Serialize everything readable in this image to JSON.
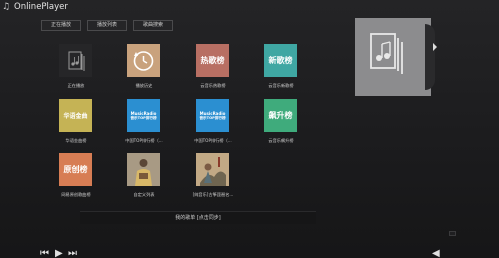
{
  "app": {
    "title": "OnlinePlayer",
    "icon": "music-note-icon"
  },
  "tabs": [
    {
      "label": "正在播放"
    },
    {
      "label": "播放列表"
    },
    {
      "label": "歌曲搜索"
    }
  ],
  "tiles": [
    {
      "caption": "正在播放",
      "icon": "music-document-icon",
      "bg": "#242426"
    },
    {
      "caption": "播放历史",
      "icon": "clock-history-icon",
      "bg": "#c9a27d"
    },
    {
      "caption": "云音乐热歌榜",
      "cover_text": "热歌榜",
      "bg": "#b86f63"
    },
    {
      "caption": "云音乐新歌榜",
      "cover_text": "新歌榜",
      "bg": "#3fa7a3"
    },
    {
      "caption": "华语金曲榜",
      "cover_text": "华语金曲",
      "bg": "#c5b355"
    },
    {
      "caption": "中国TOP排行榜（...",
      "brand_line1": "MusicRadio",
      "brand_line2": "音乐TOP排行榜",
      "bg": "#2b8fd1"
    },
    {
      "caption": "中国TOP排行榜（...",
      "brand_line1": "MusicRadio",
      "brand_line2": "音乐TOP排行榜",
      "bg": "#2b8fd1"
    },
    {
      "caption": "云音乐飙升榜",
      "cover_text": "飙升榜",
      "bg": "#3fab7c"
    },
    {
      "caption": "网易原创歌曲榜",
      "cover_text": "原创榜",
      "bg": "#d77d54"
    },
    {
      "caption": "自定义列表",
      "icon": "person-cover-icon",
      "bg": "#9b8f7c"
    },
    {
      "caption": "[纯音乐]古筝琵琶名...",
      "icon": "painting-cover-icon",
      "bg": "#b59c7a"
    }
  ],
  "sync": {
    "label": "我的歌单 [点击同步]"
  },
  "side_panel": {
    "icon": "music-document-icon"
  },
  "controls": {
    "prev_icon": "previous-icon",
    "play_icon": "play-icon",
    "next_icon": "next-icon",
    "volume_icon": "volume-icon"
  }
}
